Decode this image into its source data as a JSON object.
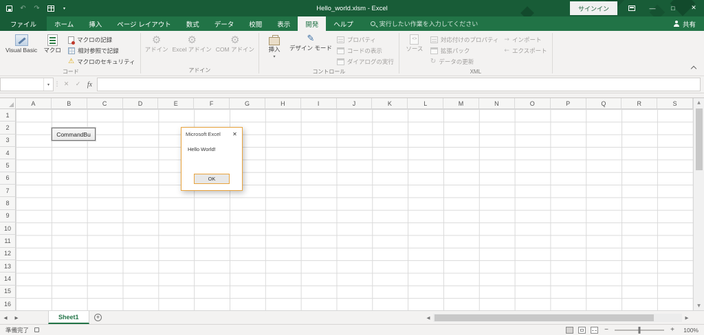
{
  "titlebar": {
    "title": "Hello_world.xlsm - Excel",
    "sign_in_label": "サインイン"
  },
  "ribbon_tabs": {
    "file": "ファイル",
    "home": "ホーム",
    "insert": "挿入",
    "page_layout": "ページ レイアウト",
    "formulas": "数式",
    "data": "データ",
    "review": "校閲",
    "view": "表示",
    "developer": "開発",
    "help": "ヘルプ",
    "search_placeholder": "実行したい作業を入力してください",
    "share_label": "共有"
  },
  "ribbon": {
    "code_group": {
      "label": "コード",
      "visual_basic": "Visual Basic",
      "macros": "マクロ",
      "record_macro": "マクロの記録",
      "use_relative_references": "相対参照で記録",
      "macro_security": "マクロのセキュリティ"
    },
    "addins_group": {
      "label": "アドイン",
      "addins": "アドイン",
      "excel_addins": "Excel アドイン",
      "com_addins": "COM アドイン"
    },
    "controls_group": {
      "label": "コントロール",
      "insert": "挿入",
      "design_mode": "デザイン モード",
      "properties": "プロパティ",
      "view_code": "コードの表示",
      "run_dialog": "ダイアログの実行"
    },
    "xml_group": {
      "label": "XML",
      "source": "ソース",
      "map_properties": "対応付けのプロパティ",
      "expansion_packs": "拡張パック",
      "refresh_data": "データの更新",
      "import": "インポート",
      "export": "エクスポート"
    }
  },
  "formula_bar": {
    "name_box_value": "",
    "fx_label": "fx",
    "formula_value": ""
  },
  "grid": {
    "columns": [
      "A",
      "B",
      "C",
      "D",
      "E",
      "F",
      "G",
      "H",
      "I",
      "J",
      "K",
      "L",
      "M",
      "N",
      "O",
      "P",
      "Q",
      "R",
      "S"
    ],
    "rows": [
      "1",
      "2",
      "3",
      "4",
      "5",
      "6",
      "7",
      "8",
      "9",
      "10",
      "11",
      "12",
      "13",
      "14",
      "15",
      "16"
    ],
    "command_button_label": "CommandBu"
  },
  "message_dialog": {
    "title": "Microsoft Excel",
    "message": "Hello World!",
    "ok_label": "OK"
  },
  "sheet_bar": {
    "sheet1_label": "Sheet1"
  },
  "status_bar": {
    "ready_label": "準備完了",
    "zoom_value": "100%"
  }
}
